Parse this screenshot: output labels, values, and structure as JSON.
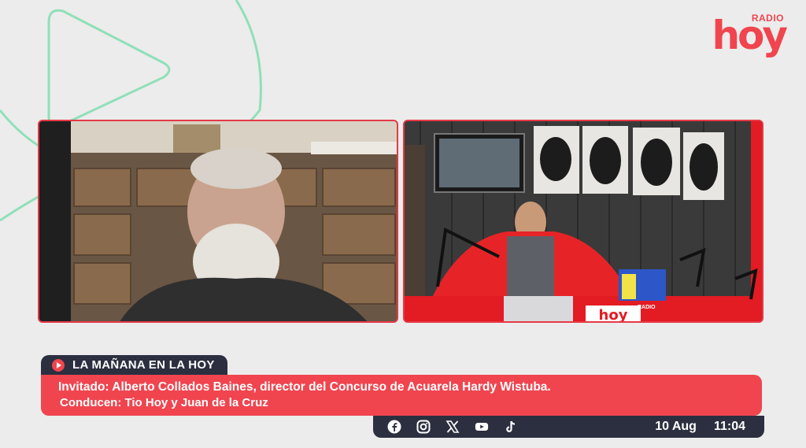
{
  "brand": {
    "radio_label": "RADIO",
    "name": "hoy",
    "color": "#f0454f"
  },
  "video": {
    "left_panel": "guest-video-feed",
    "right_panel": "studio-video-feed",
    "studio_desk_sign": "hoy",
    "studio_desk_sign_small": "RADIO"
  },
  "program": {
    "title": "LA MAÑANA EN LA HOY"
  },
  "info": {
    "line1": "Invitado: Alberto Collados Baines, director del Concurso de Acuarela Hardy Wistuba.",
    "line2": "Conducen: Tio Hoy y Juan de la Cruz"
  },
  "social": [
    "facebook-icon",
    "instagram-icon",
    "x-icon",
    "youtube-icon",
    "tiktok-icon"
  ],
  "clock": {
    "date": "10 Aug",
    "time": "11:04"
  },
  "colors": {
    "accent": "#f0454f",
    "dark": "#2b2f3f",
    "background": "#ececec",
    "deco": "#8fe0b8"
  }
}
